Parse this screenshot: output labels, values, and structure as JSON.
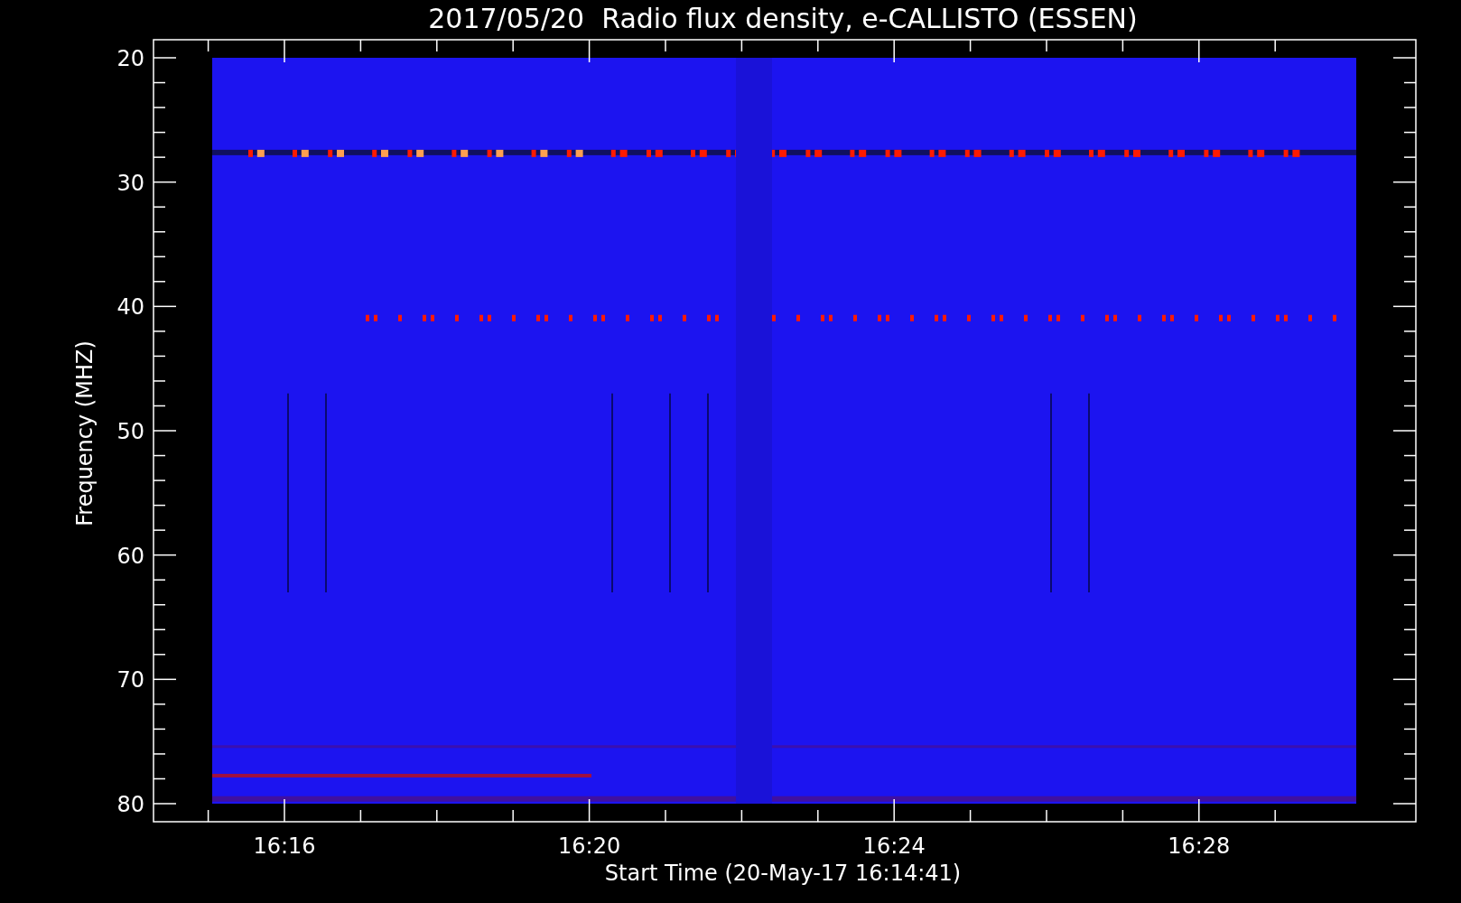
{
  "title": "2017/05/20  Radio flux density, e-CALLISTO (ESSEN)",
  "y_axis": {
    "label": "Frequency (MHZ)",
    "ticks": [
      "20",
      "30",
      "40",
      "50",
      "60",
      "70",
      "80"
    ]
  },
  "x_axis": {
    "label": "Start Time (20-May-17 16:14:41)",
    "ticks": [
      "16:16",
      "16:20",
      "16:24",
      "16:28"
    ]
  }
}
